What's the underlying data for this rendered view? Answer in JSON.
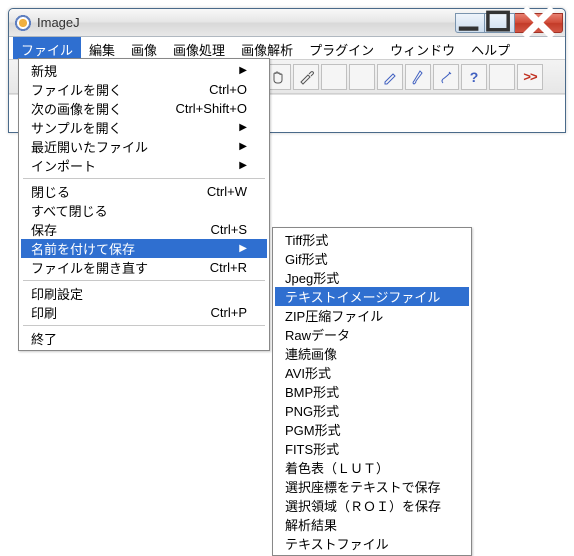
{
  "titlebar": {
    "title": "ImageJ"
  },
  "menubar": {
    "items": [
      {
        "label": "ファイル",
        "active": true
      },
      {
        "label": "編集"
      },
      {
        "label": "画像"
      },
      {
        "label": "画像処理"
      },
      {
        "label": "画像解析"
      },
      {
        "label": "プラグイン"
      },
      {
        "label": "ウィンドウ"
      },
      {
        "label": "ヘルプ"
      }
    ]
  },
  "toolbar": {
    "more": ">>"
  },
  "file_menu": {
    "new": "新規",
    "open": "ファイルを開く",
    "open_sc": "Ctrl+O",
    "open_next": "次の画像を開く",
    "open_next_sc": "Ctrl+Shift+O",
    "open_sample": "サンプルを開く",
    "recent": "最近開いたファイル",
    "import": "インポート",
    "close": "閉じる",
    "close_sc": "Ctrl+W",
    "close_all": "すべて閉じる",
    "save": "保存",
    "save_sc": "Ctrl+S",
    "save_as": "名前を付けて保存",
    "revert": "ファイルを開き直す",
    "revert_sc": "Ctrl+R",
    "page_setup": "印刷設定",
    "print": "印刷",
    "print_sc": "Ctrl+P",
    "quit": "終了"
  },
  "saveas_menu": {
    "tiff": "Tiff形式",
    "gif": "Gif形式",
    "jpeg": "Jpeg形式",
    "text_image": "テキストイメージファイル",
    "zip": "ZIP圧縮ファイル",
    "raw": "Rawデータ",
    "image_sequence": "連続画像",
    "avi": "AVI形式",
    "bmp": "BMP形式",
    "png": "PNG形式",
    "pgm": "PGM形式",
    "fits": "FITS形式",
    "lut": "着色表（ＬＵＴ）",
    "xy": "選択座標をテキストで保存",
    "roi": "選択領域（ＲＯＩ）を保存",
    "results": "解析結果",
    "text": "テキストファイル"
  }
}
